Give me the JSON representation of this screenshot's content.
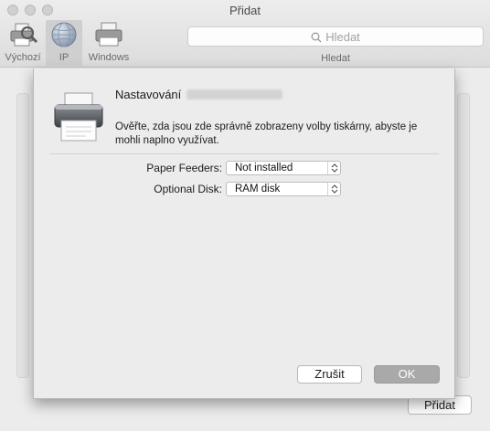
{
  "window": {
    "title": "Přidat"
  },
  "toolbar": {
    "items": [
      {
        "label": "Výchozí",
        "icon": "default-printer-icon"
      },
      {
        "label": "IP",
        "icon": "ip-globe-icon",
        "selected": true
      },
      {
        "label": "Windows",
        "icon": "windows-printer-icon"
      }
    ],
    "search": {
      "placeholder": "Hledat",
      "caption": "Hledat"
    }
  },
  "sheet": {
    "title": "Nastavování",
    "description": "Ověřte, zda jsou zde správně zobrazeny volby tiskárny, abyste je mohli naplno využívat.",
    "options": [
      {
        "label": "Paper Feeders:",
        "value": "Not installed"
      },
      {
        "label": "Optional Disk:",
        "value": "RAM disk"
      }
    ],
    "cancel_label": "Zrušit",
    "ok_label": "OK"
  },
  "background": {
    "add_label": "Přidat"
  }
}
